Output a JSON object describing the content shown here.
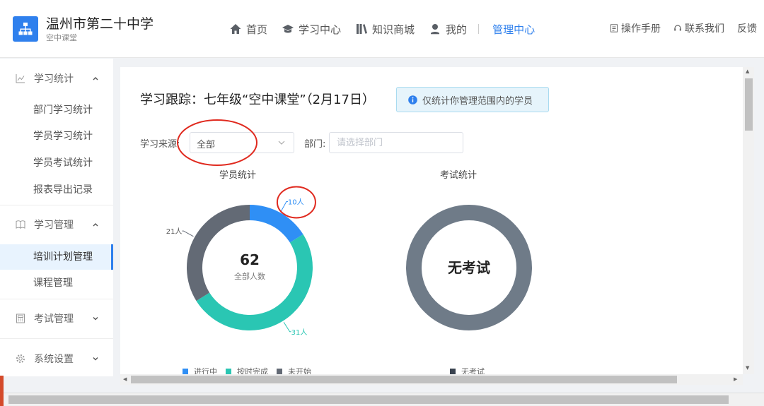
{
  "header": {
    "school_name": "温州市第二十中学",
    "school_sub": "空中课堂",
    "nav": [
      {
        "label": "首页",
        "icon": "home-icon"
      },
      {
        "label": "学习中心",
        "icon": "graduation-cap-icon"
      },
      {
        "label": "知识商城",
        "icon": "books-icon"
      },
      {
        "label": "我的",
        "icon": "user-icon"
      },
      {
        "label": "管理中心",
        "active": true
      }
    ],
    "right": [
      {
        "label": "操作手册",
        "icon": "manual-icon"
      },
      {
        "label": "联系我们",
        "icon": "headset-icon"
      },
      {
        "label": "反馈"
      }
    ]
  },
  "sidebar": {
    "groups": [
      {
        "label": "学习统计",
        "icon": "chart-icon",
        "expanded": true,
        "items": [
          "部门学习统计",
          "学员学习统计",
          "学员考试统计",
          "报表导出记录"
        ]
      },
      {
        "label": "学习管理",
        "icon": "book-icon",
        "expanded": true,
        "items": [
          "培训计划管理",
          "课程管理"
        ]
      },
      {
        "label": "考试管理",
        "icon": "calculator-icon",
        "expanded": false,
        "items": []
      },
      {
        "label": "系统设置",
        "icon": "gear-icon",
        "expanded": false,
        "items": []
      }
    ],
    "active_item": "培训计划管理"
  },
  "main": {
    "title": "学习跟踪：七年级“空中课堂”（2月17日）",
    "notice": "仅统计你管理范围内的学员",
    "filters": {
      "source_label": "学习来源:",
      "source_value": "全部",
      "dept_label": "部门:",
      "dept_placeholder": "请选择部门"
    }
  },
  "chart_data": [
    {
      "type": "pie",
      "title": "学员统计",
      "center_value": "62",
      "center_label": "全部人数",
      "categories": [
        "进行中",
        "按时完成",
        "未开始"
      ],
      "values": [
        10,
        31,
        21
      ],
      "data_labels": [
        "10人",
        "31人",
        "21人"
      ],
      "colors": [
        "#2f8ff5",
        "#2ac6b3",
        "#636a75"
      ],
      "legend_position": "bottom"
    },
    {
      "type": "pie",
      "title": "考试统计",
      "center_label": "无考试",
      "categories": [
        "无考试"
      ],
      "values": [
        1
      ],
      "colors": [
        "#6f7b88"
      ],
      "legend_position": "bottom"
    }
  ],
  "colors": {
    "accent": "#2f80ed",
    "annotation": "#e02a1f"
  }
}
